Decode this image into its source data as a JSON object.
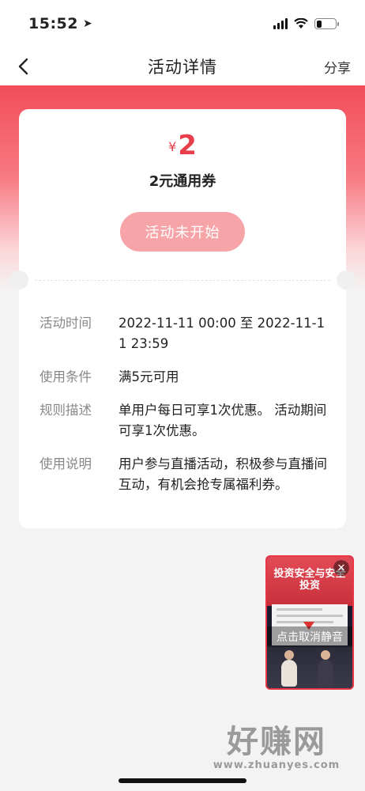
{
  "status_bar": {
    "time": "15:52"
  },
  "nav": {
    "title": "活动详情",
    "share_label": "分享"
  },
  "coupon": {
    "currency_symbol": "¥",
    "amount": "2",
    "name": "2元通用券",
    "status_button": "活动未开始"
  },
  "details": [
    {
      "label": "活动时间",
      "value": "2022-11-11 00:00 至 2022-11-11 23:59"
    },
    {
      "label": "使用条件",
      "value": "满5元可用"
    },
    {
      "label": "规则描述",
      "value": "单用户每日可享1次优惠。 活动期间可享1次优惠。"
    },
    {
      "label": "使用说明",
      "value": "用户参与直播活动，积极参与直播间互动，有机会抢专属福利券。"
    }
  ],
  "live_stream": {
    "headline": "投资安全与安全投资",
    "mute_hint": "点击取消静音"
  },
  "watermark": {
    "text": "好赚网",
    "url": "www.zhuanyes.com"
  },
  "colors": {
    "brand_red": "#e83d4b",
    "button_pink": "#f7a4a9"
  }
}
